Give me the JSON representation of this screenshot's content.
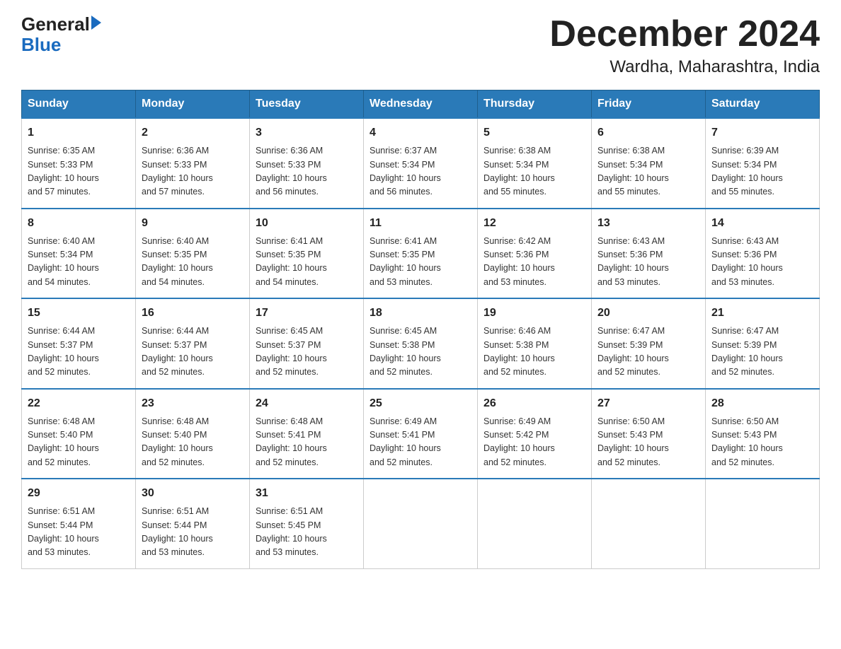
{
  "header": {
    "logo_general": "General",
    "logo_blue": "Blue",
    "month_title": "December 2024",
    "location": "Wardha, Maharashtra, India"
  },
  "weekdays": [
    "Sunday",
    "Monday",
    "Tuesday",
    "Wednesday",
    "Thursday",
    "Friday",
    "Saturday"
  ],
  "weeks": [
    [
      {
        "day": "1",
        "sunrise": "6:35 AM",
        "sunset": "5:33 PM",
        "daylight": "10 hours and 57 minutes."
      },
      {
        "day": "2",
        "sunrise": "6:36 AM",
        "sunset": "5:33 PM",
        "daylight": "10 hours and 57 minutes."
      },
      {
        "day": "3",
        "sunrise": "6:36 AM",
        "sunset": "5:33 PM",
        "daylight": "10 hours and 56 minutes."
      },
      {
        "day": "4",
        "sunrise": "6:37 AM",
        "sunset": "5:34 PM",
        "daylight": "10 hours and 56 minutes."
      },
      {
        "day": "5",
        "sunrise": "6:38 AM",
        "sunset": "5:34 PM",
        "daylight": "10 hours and 55 minutes."
      },
      {
        "day": "6",
        "sunrise": "6:38 AM",
        "sunset": "5:34 PM",
        "daylight": "10 hours and 55 minutes."
      },
      {
        "day": "7",
        "sunrise": "6:39 AM",
        "sunset": "5:34 PM",
        "daylight": "10 hours and 55 minutes."
      }
    ],
    [
      {
        "day": "8",
        "sunrise": "6:40 AM",
        "sunset": "5:34 PM",
        "daylight": "10 hours and 54 minutes."
      },
      {
        "day": "9",
        "sunrise": "6:40 AM",
        "sunset": "5:35 PM",
        "daylight": "10 hours and 54 minutes."
      },
      {
        "day": "10",
        "sunrise": "6:41 AM",
        "sunset": "5:35 PM",
        "daylight": "10 hours and 54 minutes."
      },
      {
        "day": "11",
        "sunrise": "6:41 AM",
        "sunset": "5:35 PM",
        "daylight": "10 hours and 53 minutes."
      },
      {
        "day": "12",
        "sunrise": "6:42 AM",
        "sunset": "5:36 PM",
        "daylight": "10 hours and 53 minutes."
      },
      {
        "day": "13",
        "sunrise": "6:43 AM",
        "sunset": "5:36 PM",
        "daylight": "10 hours and 53 minutes."
      },
      {
        "day": "14",
        "sunrise": "6:43 AM",
        "sunset": "5:36 PM",
        "daylight": "10 hours and 53 minutes."
      }
    ],
    [
      {
        "day": "15",
        "sunrise": "6:44 AM",
        "sunset": "5:37 PM",
        "daylight": "10 hours and 52 minutes."
      },
      {
        "day": "16",
        "sunrise": "6:44 AM",
        "sunset": "5:37 PM",
        "daylight": "10 hours and 52 minutes."
      },
      {
        "day": "17",
        "sunrise": "6:45 AM",
        "sunset": "5:37 PM",
        "daylight": "10 hours and 52 minutes."
      },
      {
        "day": "18",
        "sunrise": "6:45 AM",
        "sunset": "5:38 PM",
        "daylight": "10 hours and 52 minutes."
      },
      {
        "day": "19",
        "sunrise": "6:46 AM",
        "sunset": "5:38 PM",
        "daylight": "10 hours and 52 minutes."
      },
      {
        "day": "20",
        "sunrise": "6:47 AM",
        "sunset": "5:39 PM",
        "daylight": "10 hours and 52 minutes."
      },
      {
        "day": "21",
        "sunrise": "6:47 AM",
        "sunset": "5:39 PM",
        "daylight": "10 hours and 52 minutes."
      }
    ],
    [
      {
        "day": "22",
        "sunrise": "6:48 AM",
        "sunset": "5:40 PM",
        "daylight": "10 hours and 52 minutes."
      },
      {
        "day": "23",
        "sunrise": "6:48 AM",
        "sunset": "5:40 PM",
        "daylight": "10 hours and 52 minutes."
      },
      {
        "day": "24",
        "sunrise": "6:48 AM",
        "sunset": "5:41 PM",
        "daylight": "10 hours and 52 minutes."
      },
      {
        "day": "25",
        "sunrise": "6:49 AM",
        "sunset": "5:41 PM",
        "daylight": "10 hours and 52 minutes."
      },
      {
        "day": "26",
        "sunrise": "6:49 AM",
        "sunset": "5:42 PM",
        "daylight": "10 hours and 52 minutes."
      },
      {
        "day": "27",
        "sunrise": "6:50 AM",
        "sunset": "5:43 PM",
        "daylight": "10 hours and 52 minutes."
      },
      {
        "day": "28",
        "sunrise": "6:50 AM",
        "sunset": "5:43 PM",
        "daylight": "10 hours and 52 minutes."
      }
    ],
    [
      {
        "day": "29",
        "sunrise": "6:51 AM",
        "sunset": "5:44 PM",
        "daylight": "10 hours and 53 minutes."
      },
      {
        "day": "30",
        "sunrise": "6:51 AM",
        "sunset": "5:44 PM",
        "daylight": "10 hours and 53 minutes."
      },
      {
        "day": "31",
        "sunrise": "6:51 AM",
        "sunset": "5:45 PM",
        "daylight": "10 hours and 53 minutes."
      },
      null,
      null,
      null,
      null
    ]
  ]
}
